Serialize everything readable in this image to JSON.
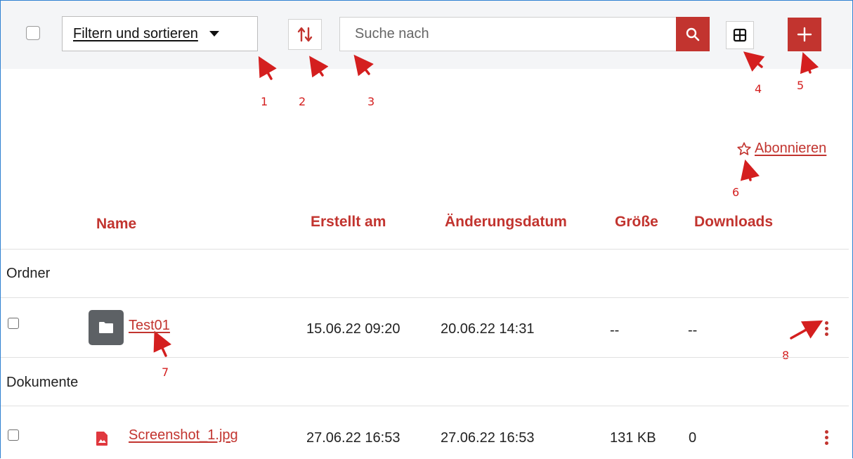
{
  "toolbar": {
    "filter_label": "Filtern und sortieren",
    "search_placeholder": "Suche nach"
  },
  "annotations": [
    "1",
    "2",
    "3",
    "4",
    "5",
    "6",
    "7",
    "8"
  ],
  "subscribe_label": "Abonnieren",
  "columns": [
    "Name",
    "Erstellt am",
    "Änderungsdatum",
    "Größe",
    "Downloads"
  ],
  "sections": {
    "folders": "Ordner",
    "documents": "Dokumente"
  },
  "folder_rows": [
    {
      "name": "Test01",
      "created": "15.06.22 09:20",
      "modified": "20.06.22 14:31",
      "size": "--",
      "downloads": "--"
    }
  ],
  "document_rows": [
    {
      "name": "Screenshot_1.jpg",
      "created": "27.06.22 16:53",
      "modified": "27.06.22 16:53",
      "size": "131 KB",
      "downloads": "0"
    }
  ],
  "colors": {
    "accent": "#c2342f",
    "annotation": "#d41f1f",
    "toolbar_bg": "#f4f5f7"
  },
  "icons": [
    "sort-icon",
    "search-icon",
    "grid-view-icon",
    "plus-icon",
    "star-icon",
    "folder-icon",
    "image-file-icon",
    "kebab-menu-icon"
  ]
}
